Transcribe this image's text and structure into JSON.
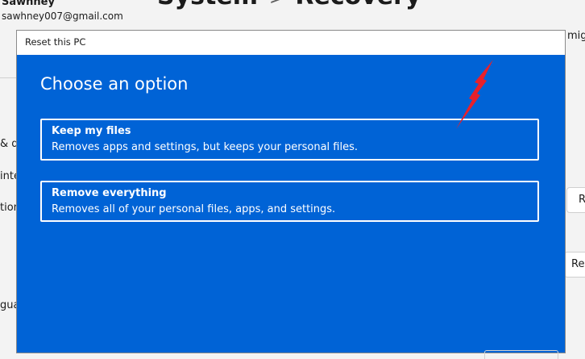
{
  "background": {
    "user_name": "Sawhney",
    "user_email": "sawhney007@gmail.com",
    "breadcrumb_parent": "System",
    "breadcrumb_separator": ">",
    "breadcrumb_current": "Recovery",
    "sidebar_fragments": [
      "& de",
      "inte",
      "tion",
      "gua"
    ],
    "right_fragments": [
      "migh",
      "R",
      "Re"
    ]
  },
  "dialog": {
    "title": "Reset this PC",
    "heading": "Choose an option",
    "options": [
      {
        "title": "Keep my files",
        "description": "Removes apps and settings, but keeps your personal files."
      },
      {
        "title": "Remove everything",
        "description": "Removes all of your personal files, apps, and settings."
      }
    ]
  },
  "colors": {
    "dialog_background": "#0063d6",
    "arrow": "#e8202a",
    "window_background": "#f3f3f3"
  },
  "icons": {
    "annotation": "red-arrow-icon"
  }
}
